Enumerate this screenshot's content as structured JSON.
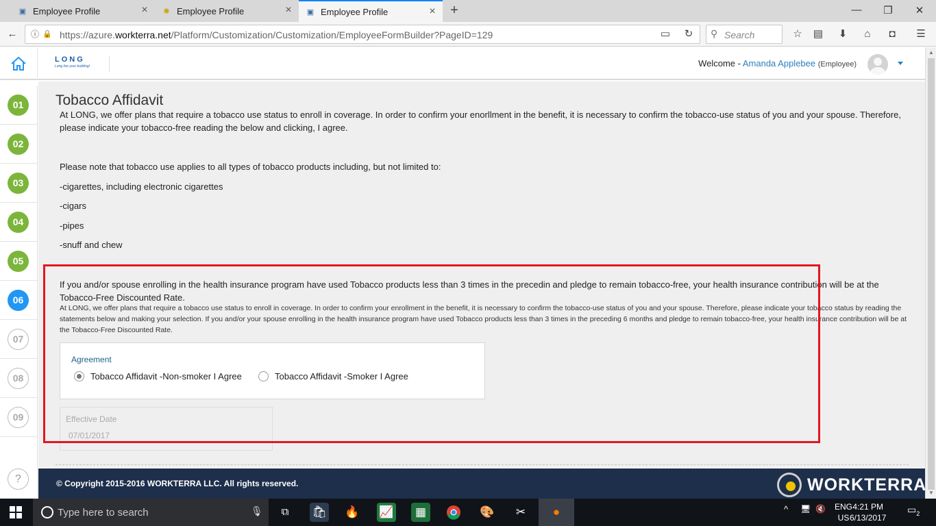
{
  "browser": {
    "tabs": [
      {
        "title": "Employee Profile"
      },
      {
        "title": "Employee Profile"
      },
      {
        "title": "Employee Profile"
      }
    ],
    "url_prefix": "https://azure.",
    "url_domain": "workterra.net",
    "url_path": "/Platform/Customization/Customization/EmployeeFormBuilder?PageID=129",
    "search_placeholder": "Search"
  },
  "header": {
    "logo_text": "LONG",
    "logo_tagline": "Long live your building!",
    "welcome_label": "Welcome -",
    "user_name": "Amanda Applebee",
    "user_role": "(Employee)"
  },
  "steps": [
    {
      "label": "01",
      "state": "done"
    },
    {
      "label": "02",
      "state": "done"
    },
    {
      "label": "03",
      "state": "done"
    },
    {
      "label": "04",
      "state": "done"
    },
    {
      "label": "05",
      "state": "done"
    },
    {
      "label": "06",
      "state": "current"
    },
    {
      "label": "07",
      "state": "todo"
    },
    {
      "label": "08",
      "state": "todo"
    },
    {
      "label": "09",
      "state": "todo"
    }
  ],
  "help_label": "?",
  "page": {
    "title": "Tobacco Affidavit",
    "intro": "At LONG, we offer plans that require a tobacco use status to enroll in coverage. In order to confirm your enorllment in the benefit, it is necessary to confirm the tobacco-use status of you and your spouse. Therefore, please indicate your tobacco-free reading the below and clicking, I agree.",
    "note": "Please note that tobacco use applies to all types of tobacco products including, but not limited to:",
    "products": [
      "-cigarettes, including electronic cigarettes",
      "-cigars",
      "-pipes",
      "-snuff and chew"
    ],
    "pledge": "If you and/or spouse enrolling in the health insurance program have used Tobacco products less than 3 times in the precedin and pledge to remain tobacco-free, your health insurance contribution will be at the Tobacco-Free Discounted Rate.",
    "fine_print": "At LONG, we offer plans that require a tobacco use status to enroll in coverage. In order to confirm your enrollment in the benefit, it is necessary to confirm the tobacco-use status of you and your spouse. Therefore, please indicate your tobacco status by reading the statements below and making your selection. If you and/or your spouse enrolling in the health insurance program have used Tobacco products less than 3 times in the preceding 6 months and pledge to remain tobacco-free, your health insurance contribution will be at the Tobacco-Free Discounted Rate.",
    "agreement": {
      "label": "Agreement",
      "options": [
        {
          "label": "Tobacco Affidavit -Non-smoker I Agree",
          "selected": true
        },
        {
          "label": "Tobacco Affidavit -Smoker I Agree",
          "selected": false
        }
      ]
    },
    "effective_date": {
      "label": "Effective Date",
      "value": "07/01/2017"
    }
  },
  "footer": {
    "copyright": "© Copyright 2015-2016 WORKTERRA LLC. All rights reserved.",
    "brand": "WORKTERRA"
  },
  "taskbar": {
    "search_placeholder": "Type here to search",
    "lang_top": "ENG",
    "lang_bottom": "US",
    "time": "4:21 PM",
    "date": "6/13/2017",
    "notifications": "2"
  },
  "colors": {
    "accent_blue": "#2196f3",
    "step_done_green": "#7cb53b",
    "footer_navy": "#1e2f4b",
    "highlight_red": "#e0171f"
  }
}
